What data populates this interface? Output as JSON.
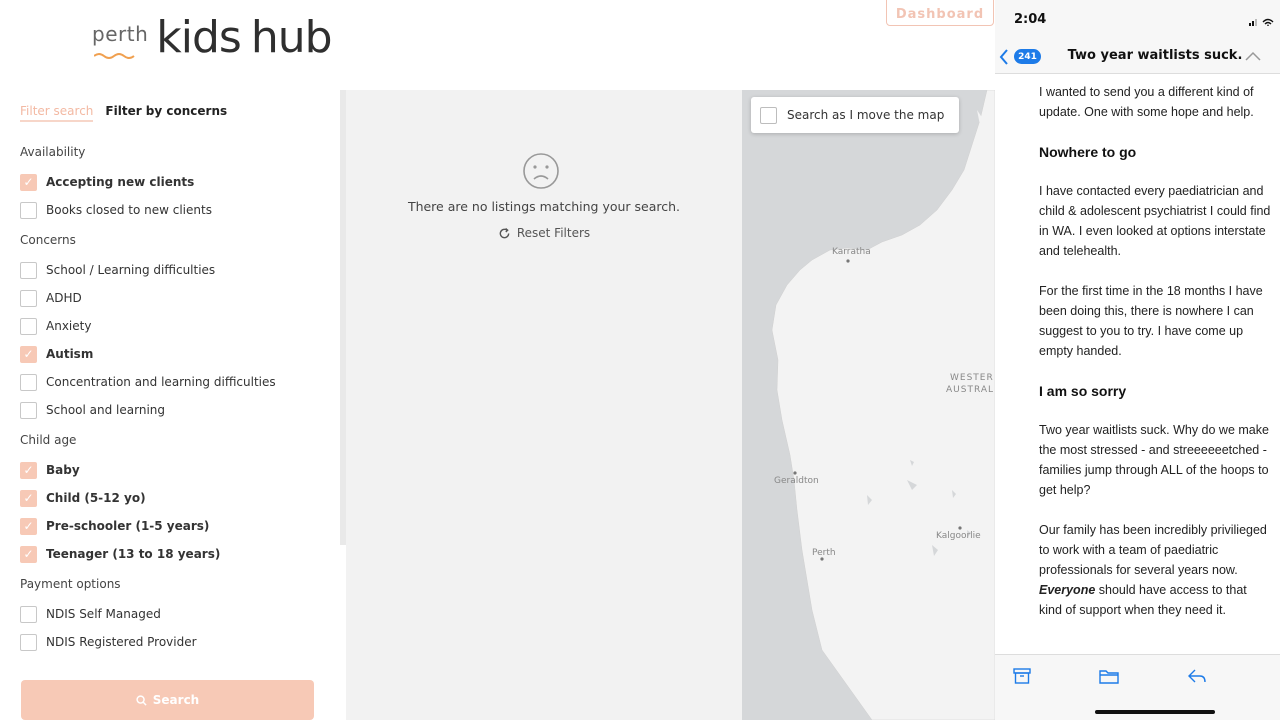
{
  "site": {
    "logo": {
      "perth": "perth",
      "kids": "kids",
      "hub": "hub"
    },
    "dashboard_label": "Dashboard",
    "tabs": [
      {
        "label": "Filter search",
        "active": true
      },
      {
        "label": "Filter by concerns",
        "active": false
      }
    ],
    "filter_groups": [
      {
        "title": "Availability",
        "options": [
          {
            "label": "Accepting new clients",
            "checked": true
          },
          {
            "label": "Books closed to new clients",
            "checked": false
          }
        ]
      },
      {
        "title": "Concerns",
        "options": [
          {
            "label": "School / Learning difficulties",
            "checked": false
          },
          {
            "label": "ADHD",
            "checked": false
          },
          {
            "label": "Anxiety",
            "checked": false
          },
          {
            "label": "Autism",
            "checked": true
          },
          {
            "label": "Concentration and learning difficulties",
            "checked": false
          },
          {
            "label": "School and learning",
            "checked": false
          }
        ]
      },
      {
        "title": "Child age",
        "options": [
          {
            "label": "Baby",
            "checked": true
          },
          {
            "label": "Child (5-12 yo)",
            "checked": true
          },
          {
            "label": "Pre-schooler (1-5 years)",
            "checked": true
          },
          {
            "label": "Teenager (13 to 18 years)",
            "checked": true
          }
        ]
      },
      {
        "title": "Payment options",
        "options": [
          {
            "label": "NDIS Self Managed",
            "checked": false
          },
          {
            "label": "NDIS Registered Provider",
            "checked": false
          }
        ]
      }
    ],
    "search_button": "Search",
    "no_results": "There are no listings matching your search.",
    "reset_filters": "Reset Filters",
    "map_search_label": "Search as I move the map",
    "map_places": {
      "karratha": "Karratha",
      "western": "WESTER",
      "australia": "AUSTRAL",
      "geraldton": "Geraldton",
      "perth": "Perth",
      "kalgoorlie": "Kalgoorlie"
    },
    "accent_color": "#f7c9b6"
  },
  "phone": {
    "time": "2:04",
    "badge_count": "241",
    "subject": "Two year waitlists suck.",
    "body": {
      "p1": "I wanted to send you a different kind of update.  One with some hope and help.",
      "h1": "Nowhere to go",
      "p2": "I have contacted every paediatrician and child & adolescent psychiatrist I could find in WA. I even looked at options interstate and telehealth.",
      "p3": "For the first time in the 18 months I have been doing this, there is nowhere I can suggest to you to try.  I have come up empty handed.",
      "h2": "I am so sorry",
      "p4": "Two year waitlists suck.  Why do we make the most stressed - and streeeeeetched - families jump through ALL of the hoops to get help?",
      "p5_start": "Our family has been incredibly privilieged to work with a team of paediatric professionals for several years now.  ",
      "p5_em": "Everyone",
      "p5_end": " should have access to that kind of support when they need it."
    },
    "toolbar_icons": [
      "archive-icon",
      "folder-icon",
      "reply-icon"
    ],
    "accent_color": "#1d7be8"
  }
}
